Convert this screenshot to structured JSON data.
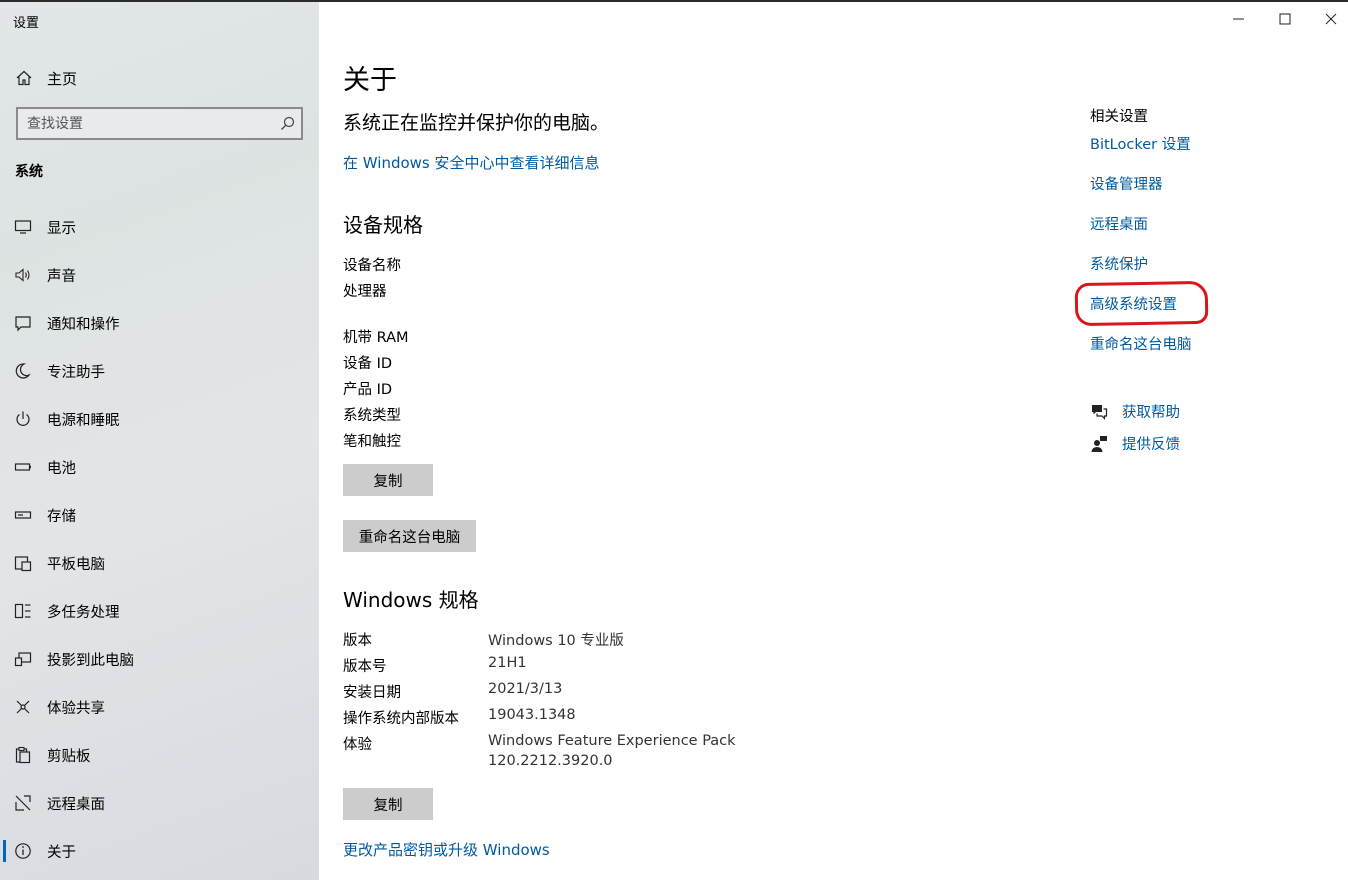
{
  "window": {
    "title": "设置",
    "controls": [
      "minimize",
      "maximize",
      "close"
    ]
  },
  "sidebar": {
    "home_label": "主页",
    "search_placeholder": "查找设置",
    "section": "系统",
    "items": [
      {
        "label": "显示",
        "icon": "display-icon"
      },
      {
        "label": "声音",
        "icon": "sound-icon"
      },
      {
        "label": "通知和操作",
        "icon": "notification-icon"
      },
      {
        "label": "专注助手",
        "icon": "moon-icon"
      },
      {
        "label": "电源和睡眠",
        "icon": "power-icon"
      },
      {
        "label": "电池",
        "icon": "battery-icon"
      },
      {
        "label": "存储",
        "icon": "storage-icon"
      },
      {
        "label": "平板电脑",
        "icon": "tablet-icon"
      },
      {
        "label": "多任务处理",
        "icon": "multitask-icon"
      },
      {
        "label": "投影到此电脑",
        "icon": "project-icon"
      },
      {
        "label": "体验共享",
        "icon": "share-icon"
      },
      {
        "label": "剪贴板",
        "icon": "clipboard-icon"
      },
      {
        "label": "远程桌面",
        "icon": "remote-desktop-icon"
      },
      {
        "label": "关于",
        "icon": "info-icon",
        "active": true
      }
    ]
  },
  "main": {
    "title": "关于",
    "status": "系统正在监控并保护你的电脑。",
    "security_link": "在 Windows 安全中心中查看详细信息",
    "device_specs": {
      "heading": "设备规格",
      "labels": [
        "设备名称",
        "处理器",
        "机带 RAM",
        "设备 ID",
        "产品 ID",
        "系统类型",
        "笔和触控"
      ],
      "copy_button": "复制",
      "rename_button": "重命名这台电脑"
    },
    "windows_specs": {
      "heading": "Windows 规格",
      "rows": [
        {
          "label": "版本",
          "value": "Windows 10 专业版"
        },
        {
          "label": "版本号",
          "value": "21H1"
        },
        {
          "label": "安装日期",
          "value": "2021/3/13"
        },
        {
          "label": "操作系统内部版本",
          "value": "19043.1348"
        },
        {
          "label": "体验",
          "value": "Windows Feature Experience Pack",
          "value2": "120.2212.3920.0"
        }
      ],
      "copy_button": "复制",
      "upgrade_link": "更改产品密钥或升级 Windows"
    }
  },
  "related": {
    "title": "相关设置",
    "links": [
      "BitLocker 设置",
      "设备管理器",
      "远程桌面",
      "系统保护",
      "高级系统设置",
      "重命名这台电脑"
    ],
    "highlighted": "高级系统设置",
    "help": {
      "get_help": "获取帮助",
      "feedback": "提供反馈"
    }
  },
  "colors": {
    "link": "#005a9e",
    "highlight_ring": "#d8161b",
    "accent": "#0067c0"
  }
}
